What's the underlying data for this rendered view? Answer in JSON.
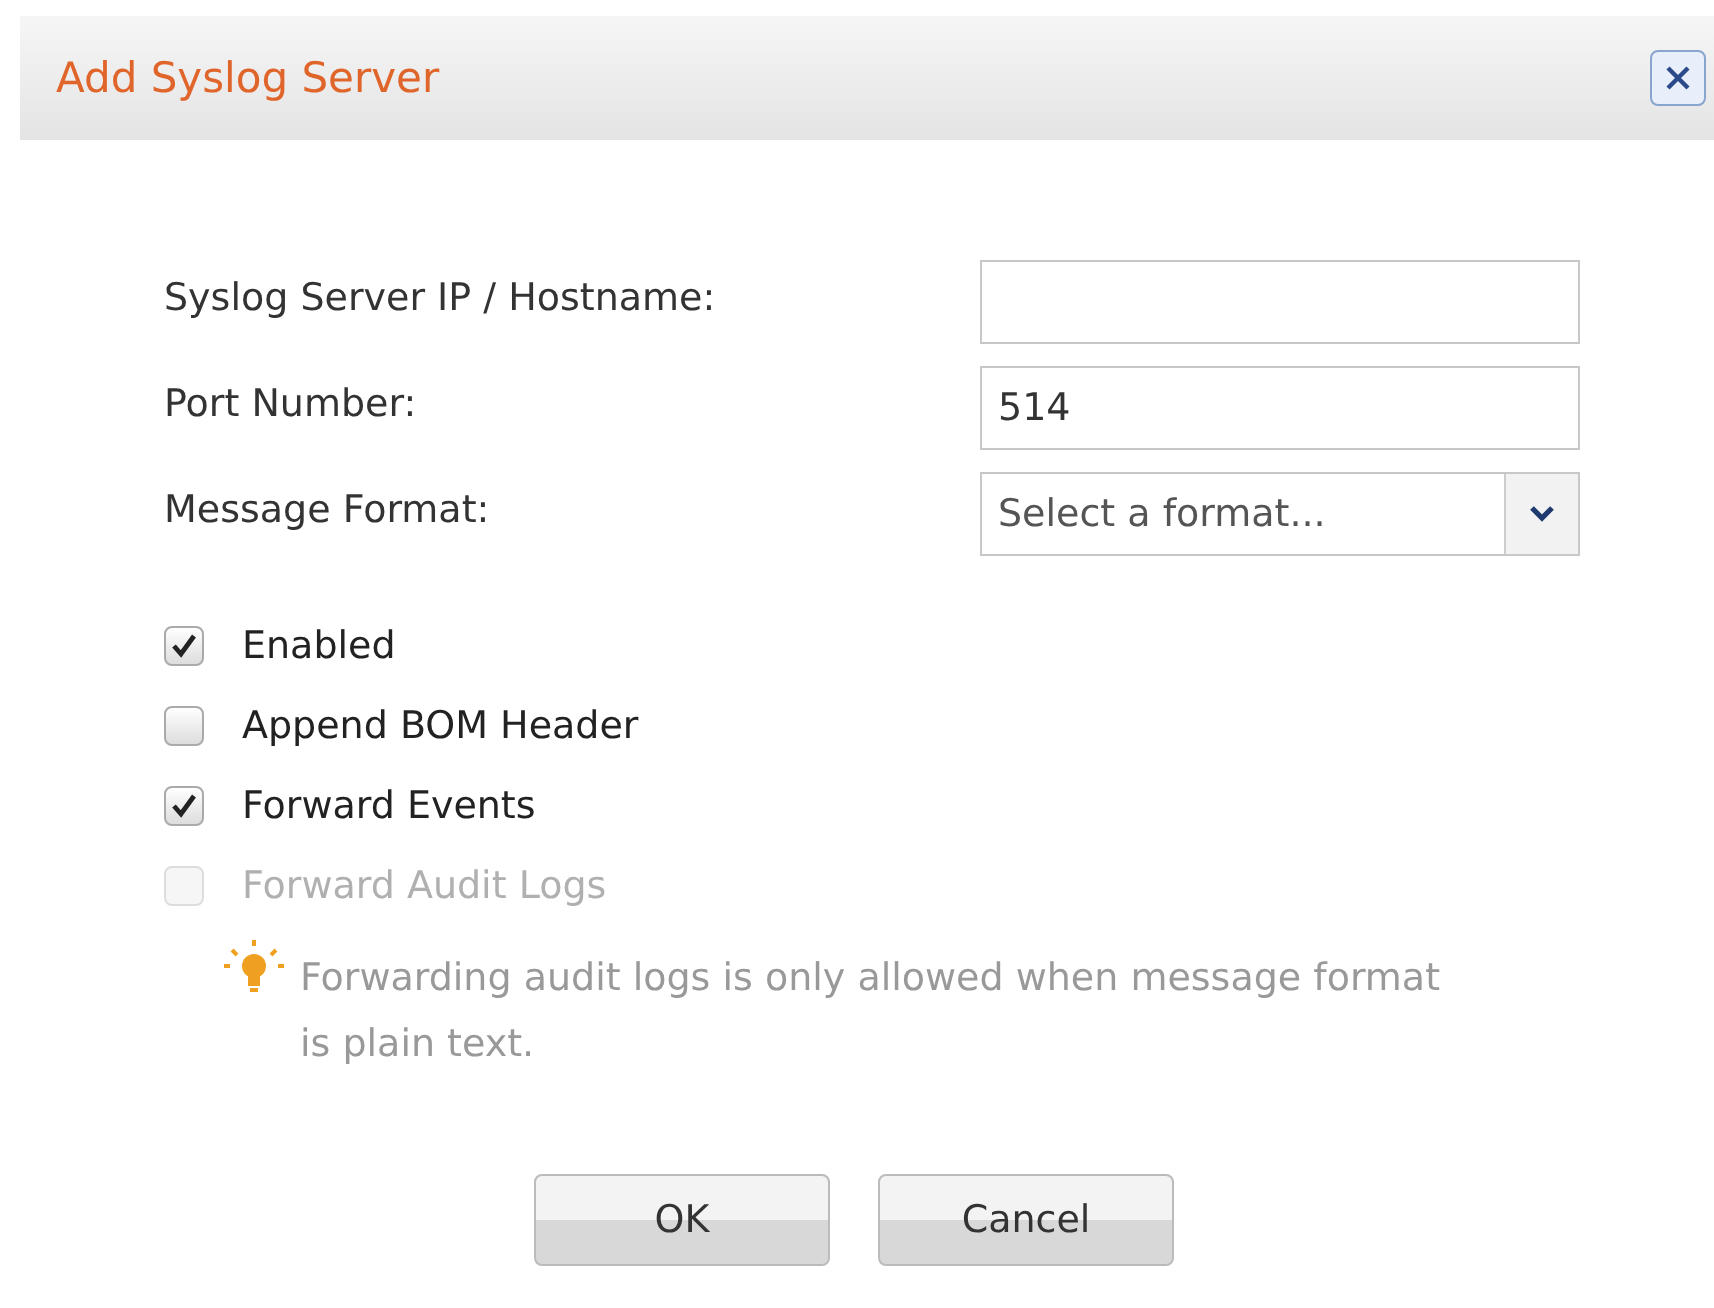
{
  "dialog": {
    "title": "Add Syslog Server"
  },
  "fields": [
    {
      "kind": "text",
      "label": "Syslog Server IP / Hostname:"
    },
    {
      "kind": "text",
      "label": "Port Number:",
      "value": "514"
    },
    {
      "kind": "select",
      "label": "Message Format:",
      "placeholder": "Select a format..."
    }
  ],
  "checkboxes": [
    {
      "label": "Enabled",
      "checked": true,
      "disabled": false
    },
    {
      "label": "Append BOM Header",
      "checked": false,
      "disabled": false
    },
    {
      "label": "Forward Events",
      "checked": true,
      "disabled": false
    },
    {
      "label": "Forward Audit Logs",
      "checked": false,
      "disabled": true
    }
  ],
  "hint": "Forwarding audit logs is only allowed when message format is plain text.",
  "buttons": [
    "OK",
    "Cancel"
  ]
}
